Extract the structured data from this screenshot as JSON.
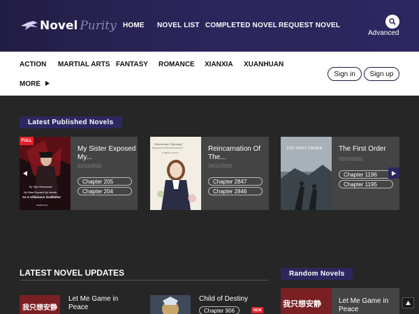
{
  "header": {
    "logo_word1": "Novel",
    "logo_word2": "Purity",
    "nav": [
      "HOME",
      "NOVEL LIST",
      "COMPLETED NOVEL",
      "REQUEST NOVEL"
    ],
    "advanced_label": "Advanced",
    "icons": {
      "search": "search-icon"
    }
  },
  "categories": {
    "items": [
      "ACTION",
      "MARTIAL ARTS",
      "FANTASY",
      "ROMANCE",
      "XIANXIA",
      "XUANHUAN"
    ],
    "more_label": "MORE",
    "signin_label": "Sign in",
    "signup_label": "Sign up"
  },
  "latest_published": {
    "heading": "Latest Published Novels",
    "cards": [
      {
        "title": "My Sister Exposed My...",
        "date": "21/11/2022",
        "badge": "FULL",
        "chapters": [
          "Chapter 205",
          "Chapter 204"
        ],
        "cover_text": [
          "By Tiger Mohammad",
          "My Sister Exposed My Identity",
          "As A Villainous Godfather",
          "WEBNOVEL"
        ]
      },
      {
        "title": "Reincarnation Of The...",
        "date": "26/11/2022",
        "chapters": [
          "Chapter 2847",
          "Chapter 2846"
        ],
        "cover_text": [
          "Aristocratic Uprising!",
          "Reincarnation Of The Weakest Noble Girl",
          "by Haiyan Lotus Yu"
        ]
      },
      {
        "title": "The First Order",
        "date": "22/11/2022",
        "chapters": [
          "Chapter 1196",
          "Chapter 1195"
        ],
        "cover_text": [
          "THE FIRST ORDER"
        ]
      }
    ]
  },
  "latest_updates": {
    "heading": "LATEST NOVEL UPDATES",
    "items": [
      {
        "title": "Let Me Game in Peace",
        "cover_text": "我只想安静"
      },
      {
        "title": "Child of Destiny",
        "chapter": "Chapter 906",
        "badge": "NEW"
      }
    ]
  },
  "random": {
    "heading": "Random Novels",
    "item": {
      "title": "Let Me Game in Peace",
      "cover_text": "我只想安静"
    }
  },
  "colors": {
    "header_bg": "#2a2559",
    "accent": "#2d2760",
    "page_bg": "#262626",
    "card_bg": "#444444",
    "badge_red": "#e3222a"
  }
}
